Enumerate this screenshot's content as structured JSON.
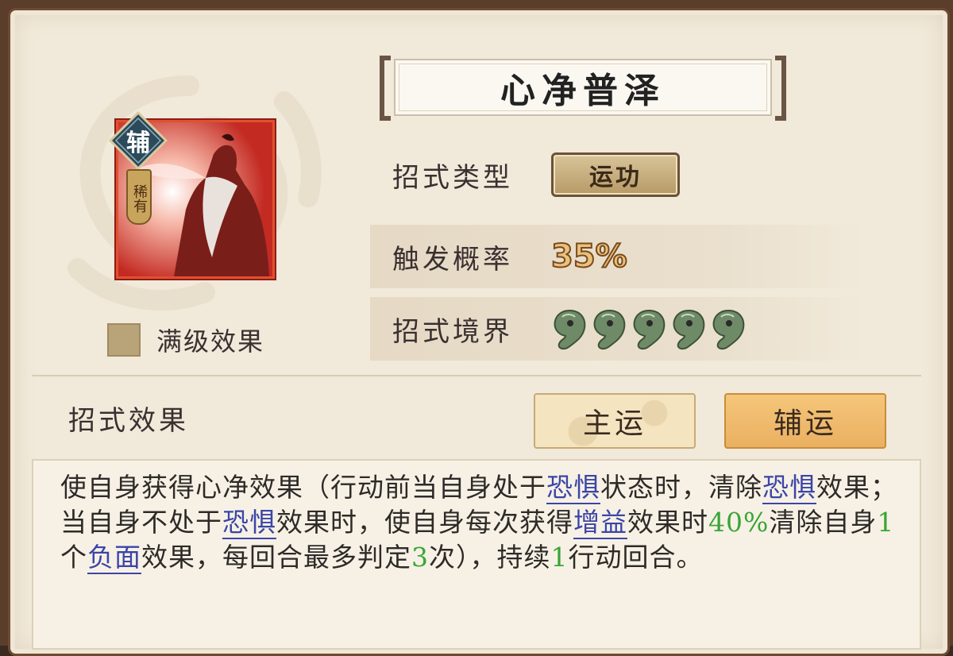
{
  "skill": {
    "name": "心净普泽",
    "role_badge": "辅",
    "rarity": "稀有",
    "max_level_label": "满级效果",
    "max_level_checked": false
  },
  "stats": {
    "type_label": "招式类型",
    "type_value": "运功",
    "trigger_label": "触发概率",
    "trigger_value": "35%",
    "realm_label": "招式境界",
    "realm_level": 5,
    "realm_icon": "jade-magatama-icon"
  },
  "effect": {
    "label": "招式效果",
    "tab_main": "主运",
    "tab_sub": "辅运",
    "active_tab": "辅运",
    "description_segments": [
      {
        "t": "使自身获得心净效果（行动前当自身处于",
        "k": "text"
      },
      {
        "t": "恐惧",
        "k": "kw"
      },
      {
        "t": "状态时，清除",
        "k": "text"
      },
      {
        "t": "恐惧",
        "k": "kw"
      },
      {
        "t": "效果；当自身不处于",
        "k": "text"
      },
      {
        "t": "恐惧",
        "k": "kw"
      },
      {
        "t": "效果时，使自身每次获得",
        "k": "text"
      },
      {
        "t": "增益",
        "k": "kw"
      },
      {
        "t": "效果时",
        "k": "text"
      },
      {
        "t": "40%",
        "k": "num"
      },
      {
        "t": "清除自身",
        "k": "text"
      },
      {
        "t": "1",
        "k": "num"
      },
      {
        "t": "个",
        "k": "text"
      },
      {
        "t": "负面",
        "k": "kw"
      },
      {
        "t": "效果，每回合最多判定",
        "k": "text"
      },
      {
        "t": "3",
        "k": "num"
      },
      {
        "t": "次），持续",
        "k": "text"
      },
      {
        "t": "1",
        "k": "num"
      },
      {
        "t": "行动回合。",
        "k": "text"
      }
    ]
  },
  "colors": {
    "keyword": "#3b45a8",
    "number": "#3aa536",
    "panel_bg": "#f1e9da",
    "active_tab": "#eab061"
  }
}
